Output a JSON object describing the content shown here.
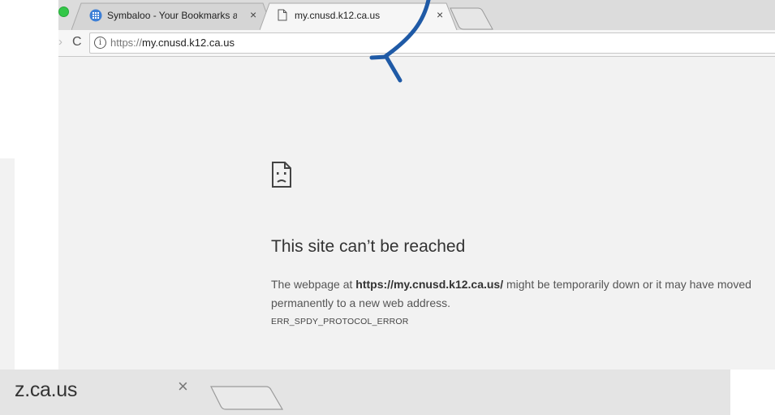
{
  "tabs": [
    {
      "title": "Symbaloo - Your Bookmarks an",
      "favicon": "symbaloo-grid-icon"
    },
    {
      "title": "my.cnusd.k12.ca.us",
      "favicon": "page-icon"
    }
  ],
  "address_bar": {
    "scheme": "https://",
    "host": "my.cnusd.k12.ca.us",
    "info_icon": "info-icon"
  },
  "error": {
    "icon": "sad-page-icon",
    "title": "This site can’t be reached",
    "body_prefix": "The webpage at ",
    "url": "https://my.cnusd.k12.ca.us/",
    "body_suffix": " might be temporarily down or it may have moved permanently to a new web address.",
    "code": "ERR_SPDY_PROTOCOL_ERROR"
  },
  "background_duplicate": {
    "url_fragment": "z.ca.us"
  },
  "annotation": {
    "type": "arrow",
    "color": "#1f5aa6"
  },
  "colors": {
    "tab_strip": "#dcdcdc",
    "page_background": "#f2f2f2",
    "traffic_light_green": "#33c748"
  }
}
